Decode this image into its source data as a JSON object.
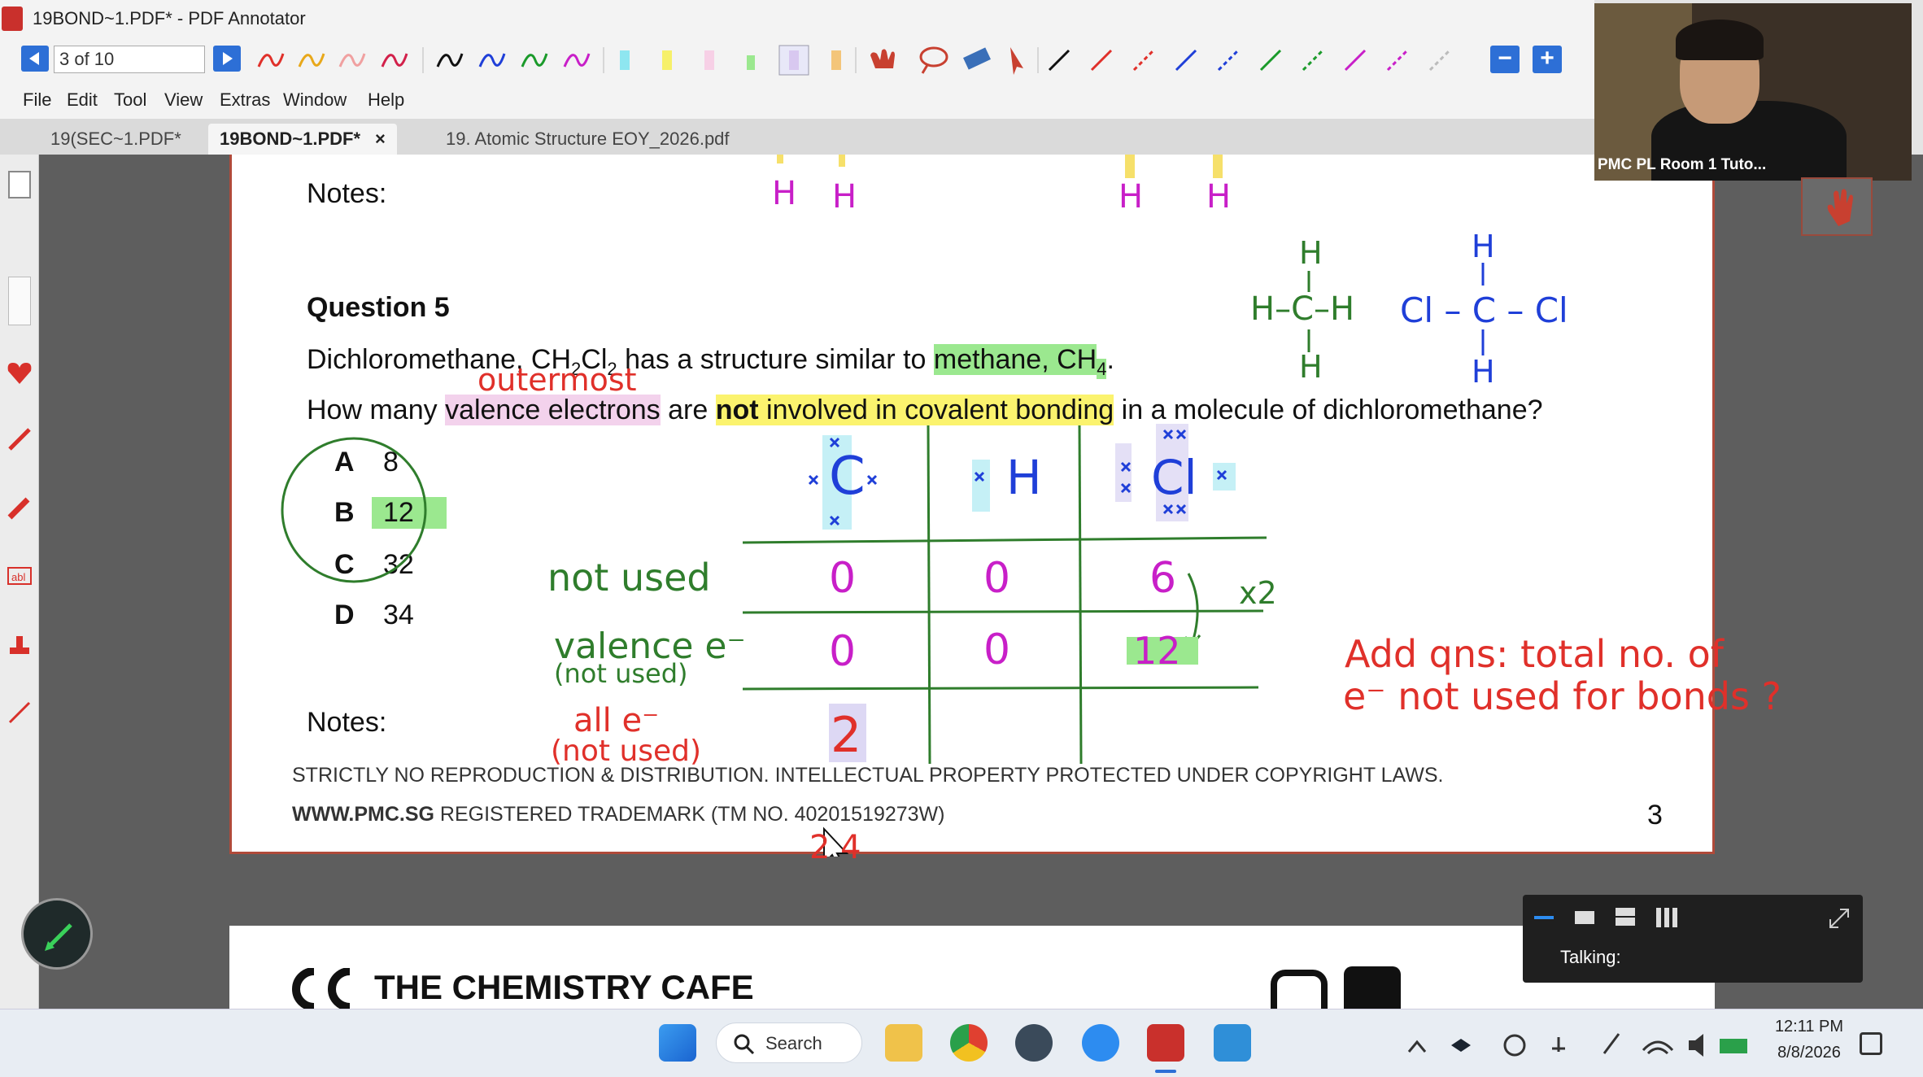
{
  "window": {
    "title": "19BOND~1.PDF* - PDF Annotator"
  },
  "toolbar": {
    "page_indicator": "3 of 10"
  },
  "menu": [
    "File",
    "Edit",
    "Tool",
    "View",
    "Extras",
    "Window",
    "Help"
  ],
  "tabs": [
    {
      "label": "19(SEC~1.PDF*",
      "active": false
    },
    {
      "label": "19BOND~1.PDF*",
      "active": true,
      "close": "×"
    },
    {
      "label": "19. Atomic Structure EOY_2026.pdf",
      "active": false
    }
  ],
  "document": {
    "notes_top": "Notes:",
    "question_title": "Question 5",
    "q_line1_pre": "Dichloromethane, CH",
    "q_sub1": "2",
    "q_cl": "Cl",
    "q_sub2": "2",
    "q_line1_mid": " has a structure similar to ",
    "q_methane": "methane, CH",
    "q_sub3": "4",
    "q_dot": ".",
    "q_line2_a": "How many ",
    "q_line2_valence": "valence electrons",
    "q_line2_b": " are ",
    "q_line2_not": "not",
    "q_line2_c": " involved in covalent bonding",
    "q_line2_d": " in a molecule of dichloromethane?",
    "options": [
      {
        "letter": "A",
        "value": "8"
      },
      {
        "letter": "B",
        "value": "12"
      },
      {
        "letter": "C",
        "value": "32"
      },
      {
        "letter": "D",
        "value": "34"
      }
    ],
    "notes_bottom": "Notes:",
    "footer_line1": "STRICTLY NO REPRODUCTION & DISTRIBUTION. INTELLECTUAL PROPERTY PROTECTED UNDER COPYRIGHT LAWS.",
    "footer_www": "WWW.PMC.SG",
    "footer_line2": " REGISTERED TRADEMARK (TM NO. 40201519273W)",
    "page_number": "3",
    "next_page_header": "THE CHEMISTRY CAFE"
  },
  "annotations": {
    "outermost": "outermost",
    "not_used": "not used",
    "valence_e": "valence e⁻",
    "valence_e_sub": "(not used)",
    "all_e": "all  e⁻",
    "all_e_sub": "(not used)",
    "atom_c": "C",
    "atom_h": "H",
    "atom_cl": "Cl",
    "row1": [
      "0",
      "0",
      "6"
    ],
    "row2": [
      "0",
      "0",
      "12"
    ],
    "row3": [
      "2"
    ],
    "times2": "x2",
    "add_qns_line1": "Add qns: total no. of",
    "add_qns_line2": "e⁻ not used for bonds ?",
    "below_page": "2   4",
    "top_h_labels": [
      "H",
      "H",
      "H",
      "H"
    ],
    "methane_struct": {
      "top": "H",
      "mid": "H–C–H",
      "bottom": "H"
    },
    "dcm_struct": {
      "top": "H",
      "mid": "Cl – C – Cl",
      "bottom": "H"
    }
  },
  "video": {
    "participant_name": "PMC PL Room 1 Tuto..."
  },
  "meeting_panel": {
    "talking_label": "Talking:"
  },
  "taskbar": {
    "search_label": "Search",
    "time": "12:11 PM",
    "date": "8/8/2026"
  },
  "colors": {
    "accent_blue": "#2d6fd6",
    "annot_green": "#2f7d2c",
    "annot_magenta": "#c81fc8",
    "annot_red": "#e0302a",
    "annot_blue": "#1f3fd8"
  }
}
